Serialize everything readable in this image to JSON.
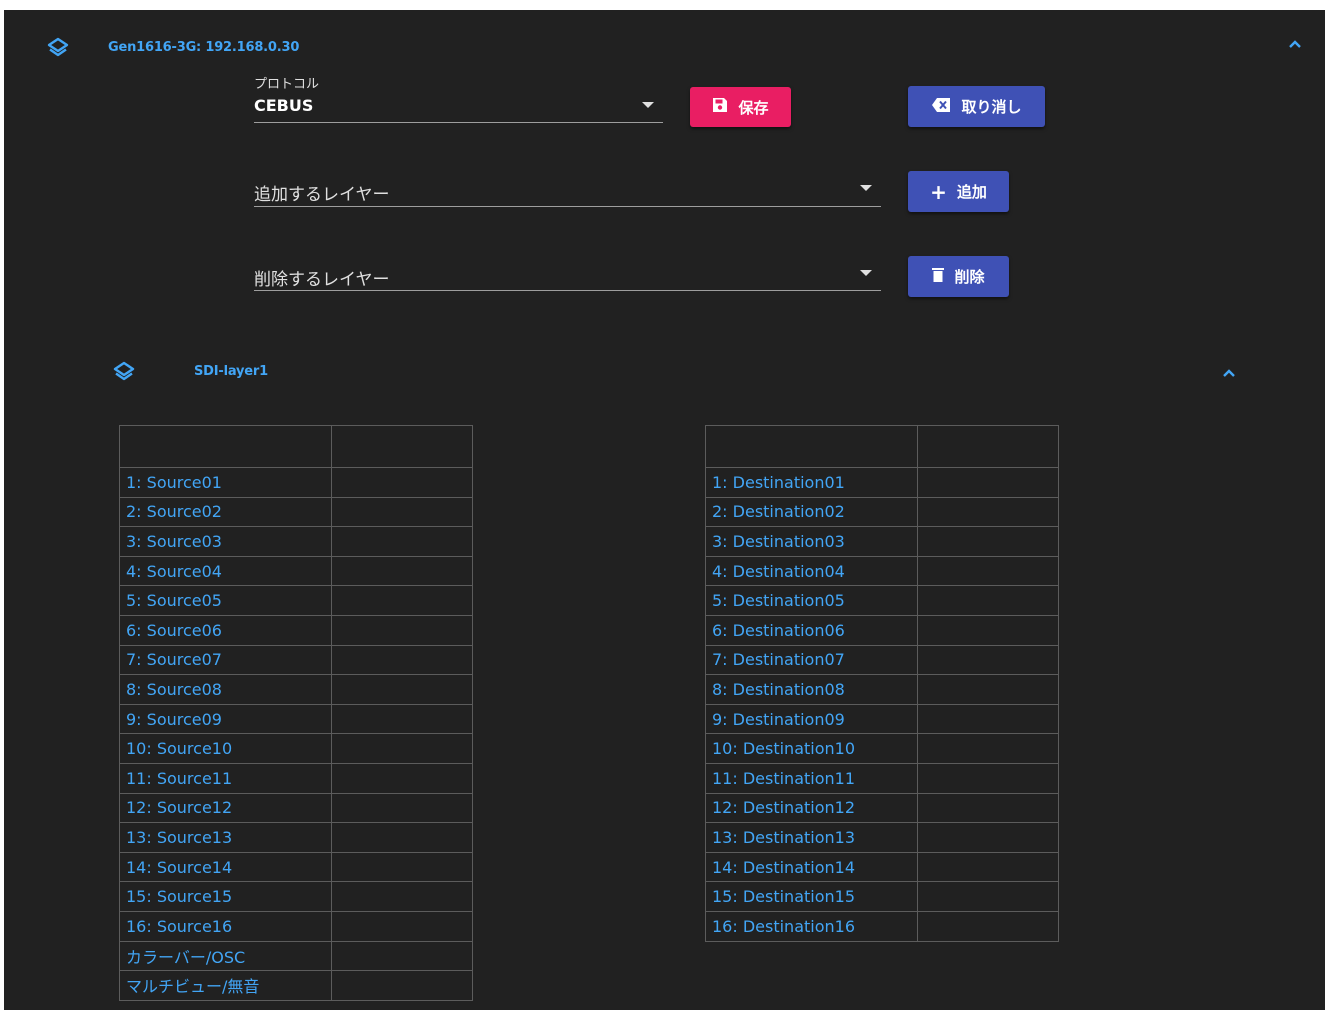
{
  "device": {
    "title": "Gen1616-3G: 192.168.0.30"
  },
  "protocol": {
    "label": "プロトコル",
    "value": "CEBUS"
  },
  "buttons": {
    "save": "保存",
    "cancel": "取り消し",
    "add": "追加",
    "delete": "削除"
  },
  "layer_add": {
    "placeholder": "追加するレイヤー"
  },
  "layer_delete": {
    "placeholder": "削除するレイヤー"
  },
  "layer": {
    "title": "SDI-layer1"
  },
  "sources": [
    "1: Source01",
    "2: Source02",
    "3: Source03",
    "4: Source04",
    "5: Source05",
    "6: Source06",
    "7: Source07",
    "8: Source08",
    "9: Source09",
    "10: Source10",
    "11: Source11",
    "12: Source12",
    "13: Source13",
    "14: Source14",
    "15: Source15",
    "16: Source16",
    "カラーバー/OSC",
    "マルチビュー/無音"
  ],
  "destinations": [
    "1: Destination01",
    "2: Destination02",
    "3: Destination03",
    "4: Destination04",
    "5: Destination05",
    "6: Destination06",
    "7: Destination07",
    "8: Destination08",
    "9: Destination09",
    "10: Destination10",
    "11: Destination11",
    "12: Destination12",
    "13: Destination13",
    "14: Destination14",
    "15: Destination15",
    "16: Destination16"
  ],
  "colors": {
    "accent": "#42a5f5",
    "save": "#e91e63",
    "primary": "#3f51b5",
    "background": "#212121"
  }
}
